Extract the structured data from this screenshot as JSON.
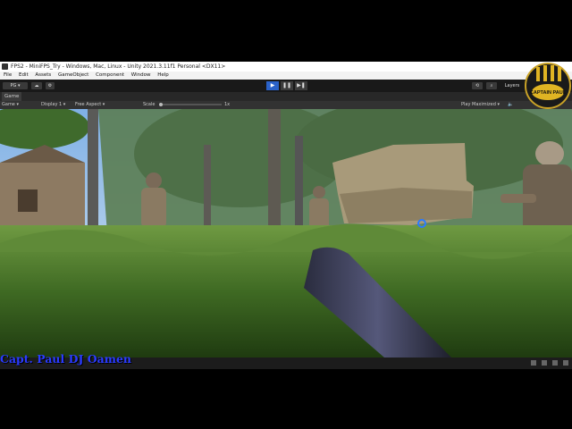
{
  "window": {
    "title": "FPS2 - MiniFPS_Try - Windows, Mac, Linux - Unity 2021.3.11f1 Personal <DX11>"
  },
  "menu": [
    "File",
    "Edit",
    "Assets",
    "GameObject",
    "Component",
    "Window",
    "Help"
  ],
  "toolbar": {
    "account_label": "PG",
    "layers_label": "Layers"
  },
  "tab": {
    "label": "Game"
  },
  "game_bar": {
    "mode": "Game",
    "display": "Display 1",
    "aspect": "Free Aspect",
    "scale_label": "Scale",
    "scale_value": "1x",
    "play_mode": "Play Maximized"
  },
  "watermark": {
    "text": "Capt. Paul DJ Oamen"
  },
  "logo": {
    "text": "CAPTAIN PAUL"
  },
  "icons": [
    "play-icon",
    "pause-icon",
    "step-icon",
    "cloud-icon",
    "history-icon",
    "search-icon",
    "mute-icon",
    "crosshair-icon"
  ]
}
